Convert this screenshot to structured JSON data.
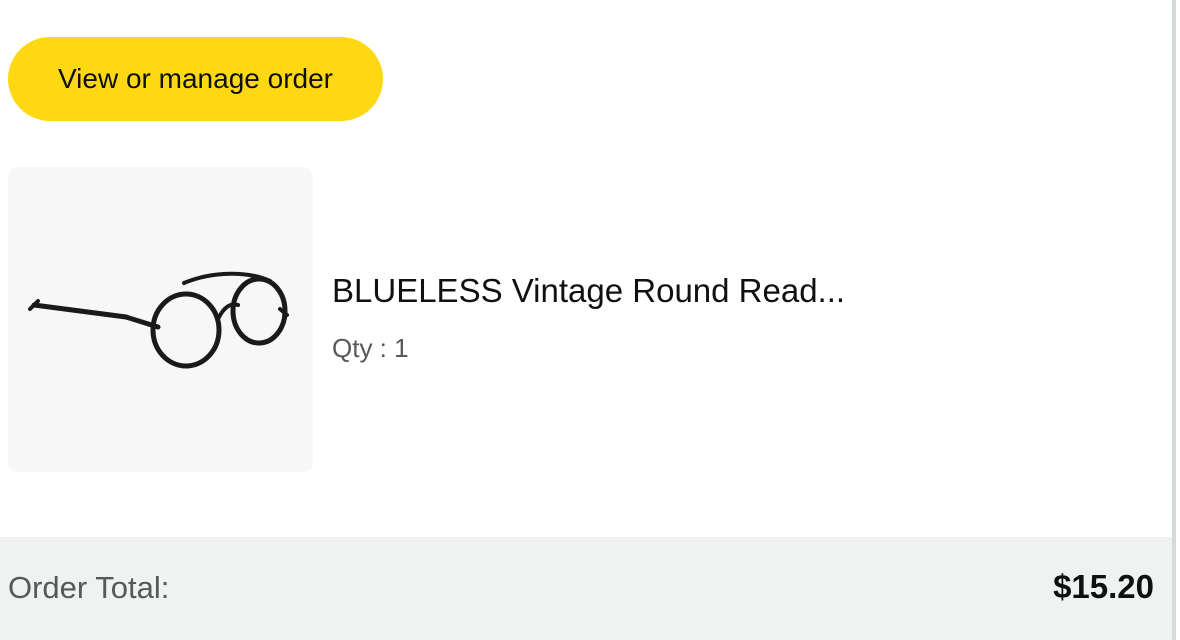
{
  "order": {
    "manage_button_label": "View or manage order"
  },
  "item": {
    "title": "BLUELESS Vintage Round Read...",
    "qty_label": "Qty : 1",
    "image_icon": "round-reading-glasses-image"
  },
  "summary": {
    "total_label": "Order Total:",
    "total_value": "$15.20"
  },
  "colors": {
    "button_bg": "#ffd814",
    "total_bar_bg": "#f0f2f2",
    "thumb_bg": "#f7f7f7"
  }
}
